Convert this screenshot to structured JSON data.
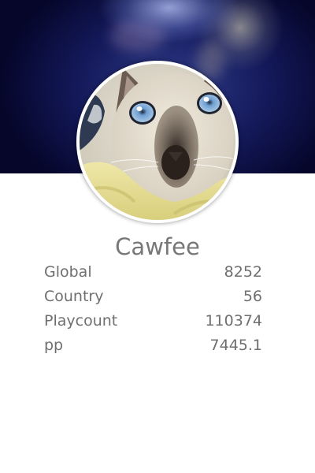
{
  "profile": {
    "username": "Cawfee",
    "avatar_icon": "siamese-kitten-avatar",
    "cover_image": "blurred-blue-cover-photo"
  },
  "stats": [
    {
      "label": "Global",
      "value": "8252"
    },
    {
      "label": "Country",
      "value": "56"
    },
    {
      "label": "Playcount",
      "value": "110374"
    },
    {
      "label": "pp",
      "value": "7445.1"
    }
  ],
  "colors": {
    "text": "#777777",
    "background": "#ffffff",
    "cover_dark": "#05062a"
  }
}
